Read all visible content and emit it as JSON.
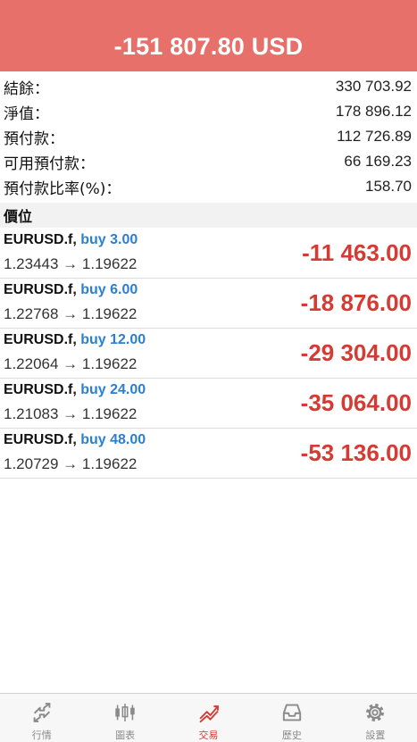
{
  "header": {
    "total_profit": "-151 807.80 USD"
  },
  "summary": [
    {
      "label": "結餘：",
      "value": "330 703.92"
    },
    {
      "label": "淨值：",
      "value": "178 896.12"
    },
    {
      "label": "預付款：",
      "value": "112 726.89"
    },
    {
      "label": "可用預付款：",
      "value": "66 169.23"
    },
    {
      "label": "預付款比率(%)：",
      "value": "158.70"
    }
  ],
  "positions_header": "價位",
  "positions": [
    {
      "symbol": "EURUSD.f,",
      "type": "buy 3.00",
      "prices": "1.23443 → 1.19622",
      "profit": "-11 463.00"
    },
    {
      "symbol": "EURUSD.f,",
      "type": "buy 6.00",
      "prices": "1.22768 → 1.19622",
      "profit": "-18 876.00"
    },
    {
      "symbol": "EURUSD.f,",
      "type": "buy 12.00",
      "prices": "1.22064 → 1.19622",
      "profit": "-29 304.00"
    },
    {
      "symbol": "EURUSD.f,",
      "type": "buy 24.00",
      "prices": "1.21083 → 1.19622",
      "profit": "-35 064.00"
    },
    {
      "symbol": "EURUSD.f,",
      "type": "buy 48.00",
      "prices": "1.20729 → 1.19622",
      "profit": "-53 136.00"
    }
  ],
  "tabbar": [
    {
      "label": "行情",
      "icon": "quotes-icon"
    },
    {
      "label": "圖表",
      "icon": "chart-icon"
    },
    {
      "label": "交易",
      "icon": "trade-icon",
      "active": true
    },
    {
      "label": "歷史",
      "icon": "history-icon"
    },
    {
      "label": "設置",
      "icon": "settings-icon"
    }
  ],
  "colors": {
    "header_bg": "#e8706a",
    "loss": "#d63a32",
    "buy": "#2a7fd4"
  }
}
